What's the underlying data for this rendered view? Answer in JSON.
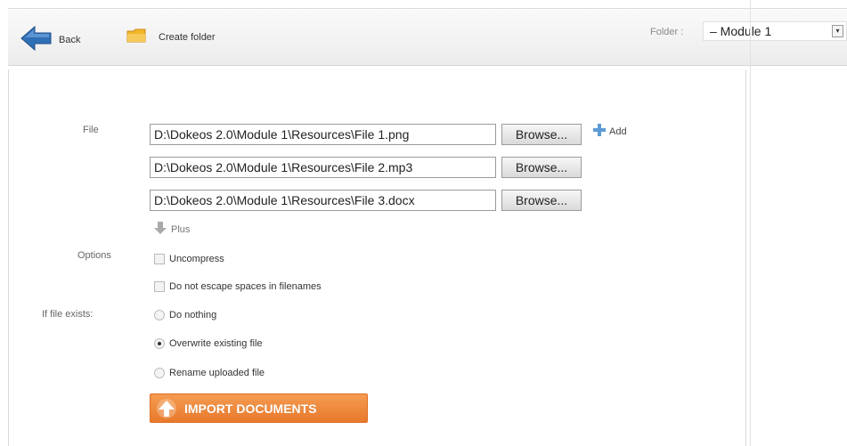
{
  "toolbar": {
    "back_label": "Back",
    "create_folder_label": "Create folder",
    "folder_label": "Folder :",
    "folder_value": "– Module 1"
  },
  "form": {
    "file_label": "File",
    "files": [
      {
        "path": "D:\\Dokeos 2.0\\Module 1\\Resources\\File 1.png",
        "browse_label": "Browse..."
      },
      {
        "path": "D:\\Dokeos 2.0\\Module 1\\Resources\\File 2.mp3",
        "browse_label": "Browse..."
      },
      {
        "path": "D:\\Dokeos 2.0\\Module 1\\Resources\\File 3.docx",
        "browse_label": "Browse..."
      }
    ],
    "add_label": "Add",
    "plus_label": "Plus",
    "options_label": "Options",
    "options": [
      {
        "label": "Uncompress",
        "checked": false
      },
      {
        "label": "Do not escape spaces in filenames",
        "checked": false
      }
    ],
    "if_exists_label": "If file exists:",
    "if_exists_options": [
      {
        "label": "Do nothing",
        "checked": false
      },
      {
        "label": "Overwrite existing file",
        "checked": true
      },
      {
        "label": "Rename uploaded file",
        "checked": false
      }
    ],
    "import_label": "IMPORT DOCUMENTS"
  },
  "colors": {
    "accent": "#e8792b",
    "back_arrow": "#2f6fb5",
    "folder_icon": "#f2b52b",
    "add_icon": "#5b9bd5"
  },
  "icons": {
    "back": "back-arrow-icon",
    "create_folder": "folder-icon",
    "add": "plus-icon",
    "plus": "down-arrow-icon",
    "import": "upload-arrow-icon",
    "dropdown": "chevron-down-icon"
  }
}
